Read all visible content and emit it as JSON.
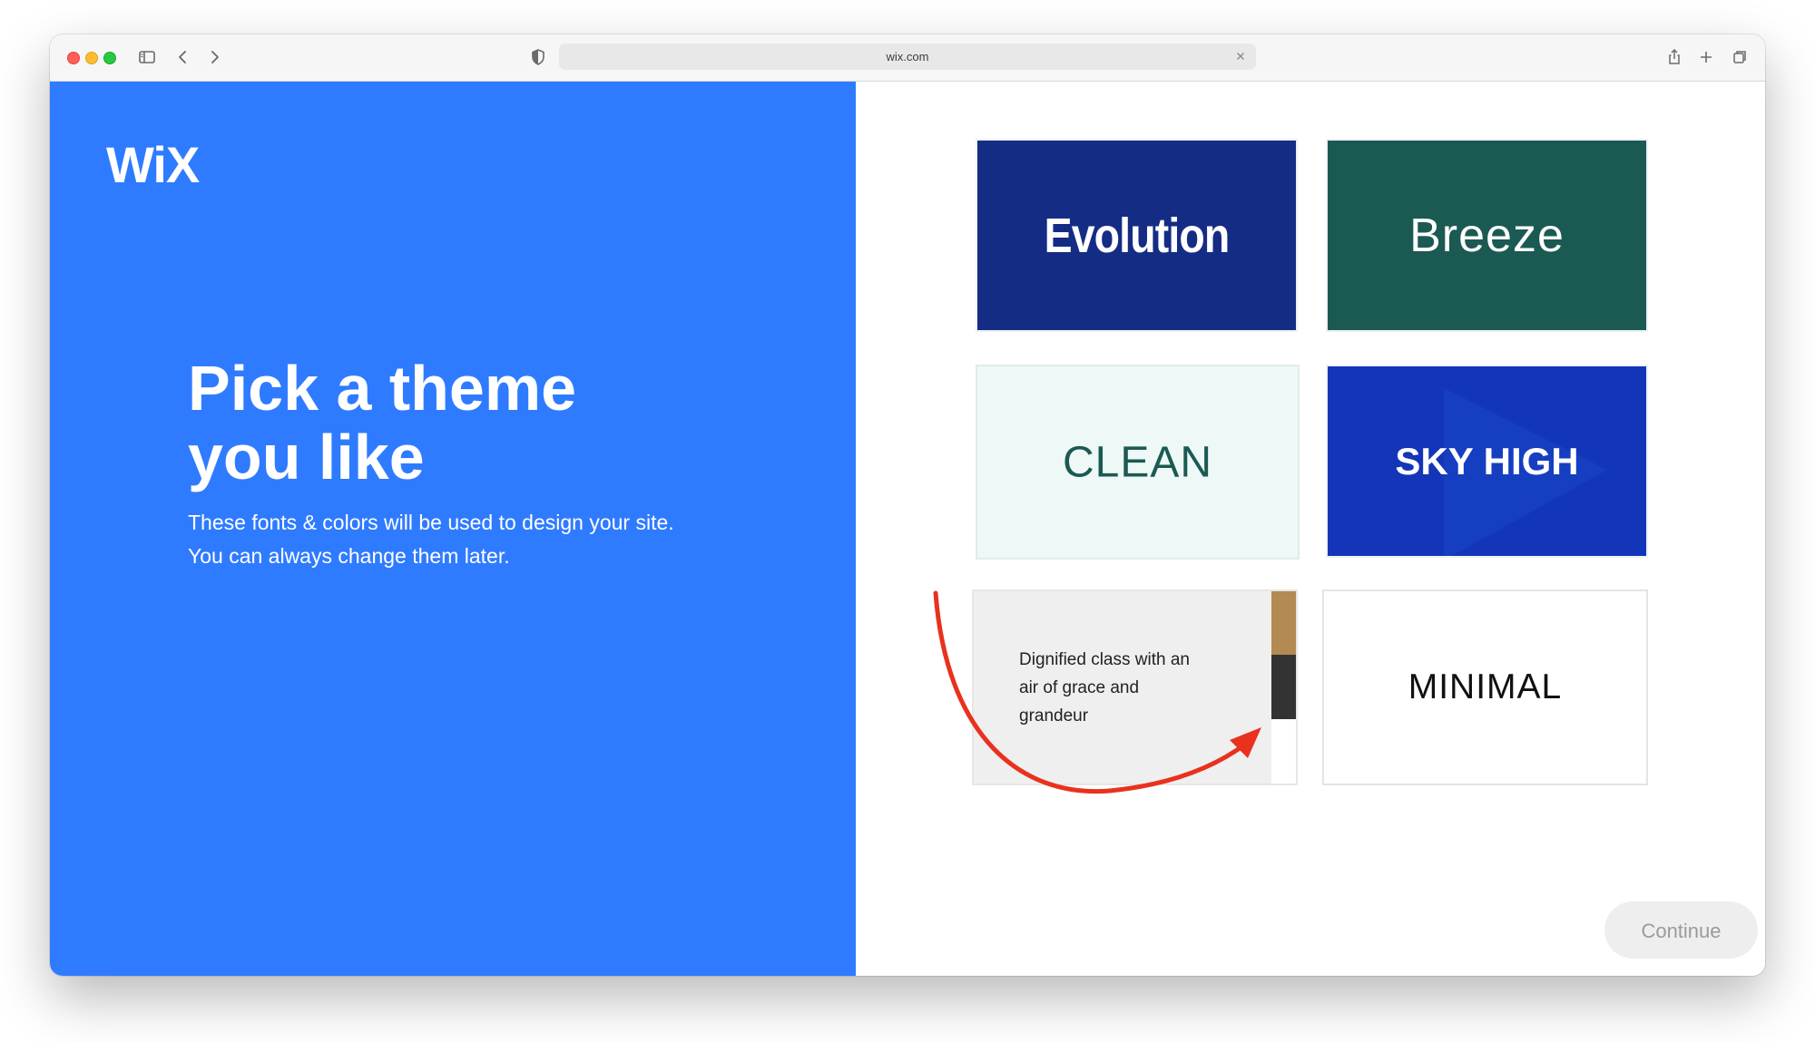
{
  "browser": {
    "url": "wix.com"
  },
  "page": {
    "logo_text": "WiX",
    "headline_lines": [
      "Pick a theme",
      "you like"
    ],
    "subtext_lines": [
      "These fonts & colors will be used to design your site.",
      "You can always change them later."
    ]
  },
  "themes": [
    {
      "id": "evolution",
      "label": "Evolution",
      "background": "#152c85",
      "text_color": "#ffffff"
    },
    {
      "id": "breeze",
      "label": "Breeze",
      "background": "#1b5a52",
      "text_color": "#ffffff"
    },
    {
      "id": "clean",
      "label": "CLEAN",
      "background": "#eef8f6",
      "text_color": "#1b5a52"
    },
    {
      "id": "sky-high",
      "label": "SKY HIGH",
      "background": "#1336b8",
      "text_color": "#ffffff"
    },
    {
      "id": "dignified",
      "label_lines": [
        "Dignified class with an",
        "air of grace and",
        "grandeur"
      ],
      "background": "#efefef",
      "text_color": "#222222",
      "swatches": [
        "#b38a52",
        "#333333",
        "#ffffff"
      ]
    },
    {
      "id": "minimal",
      "label": "MINIMAL",
      "background": "#ffffff",
      "text_color": "#111111"
    }
  ],
  "continue_label": "Continue",
  "colors": {
    "left_panel": "#2f7bff",
    "annotation_arrow": "#e8321e"
  }
}
